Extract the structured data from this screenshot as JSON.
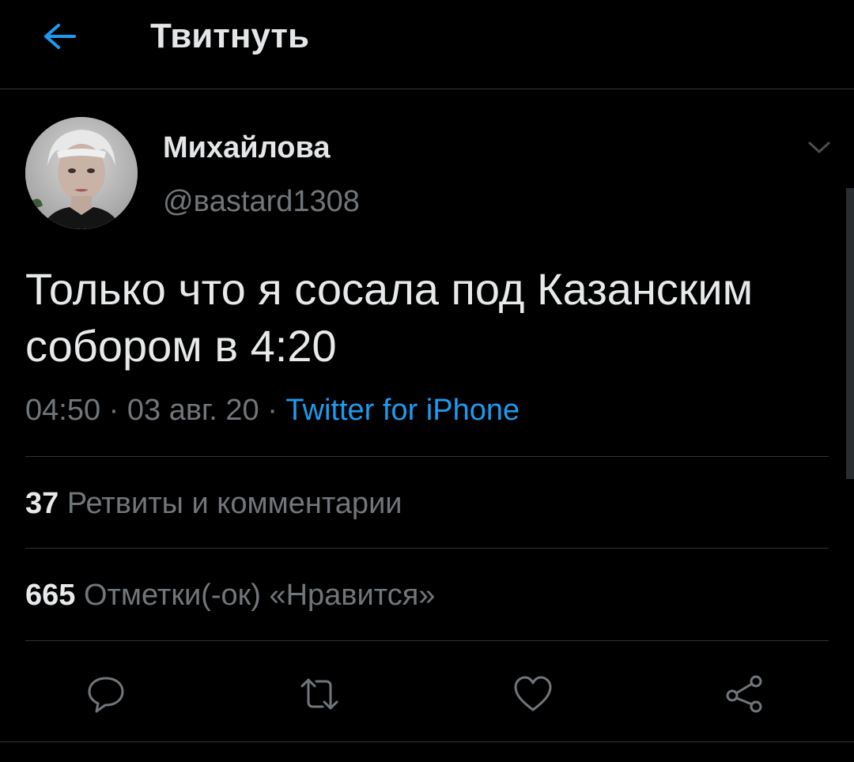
{
  "header": {
    "title": "Твитнуть",
    "back_icon": "arrow-left-icon",
    "accent": "#1d9bf0"
  },
  "author": {
    "name": "Михайлова",
    "handle": "@вastard1308",
    "avatar": "avatar-photo"
  },
  "tweet": {
    "text": "Только что я сосала под Казанским собором в 4:20",
    "time": "04:50",
    "date": "03 авг. 20",
    "source": "Twitter for iPhone"
  },
  "stats": {
    "retweets_count": "37",
    "retweets_label": "Ретвиты и комментарии",
    "likes_count": "665",
    "likes_label": "Отметки(-ок) «Нравится»"
  },
  "actions": [
    {
      "icon": "reply-icon"
    },
    {
      "icon": "retweet-icon"
    },
    {
      "icon": "like-icon"
    },
    {
      "icon": "share-icon"
    }
  ],
  "colors": {
    "background": "#000000",
    "text": "#e7e9ea",
    "secondary": "#71767b",
    "divider": "#2f3336",
    "link": "#1d9bf0"
  }
}
